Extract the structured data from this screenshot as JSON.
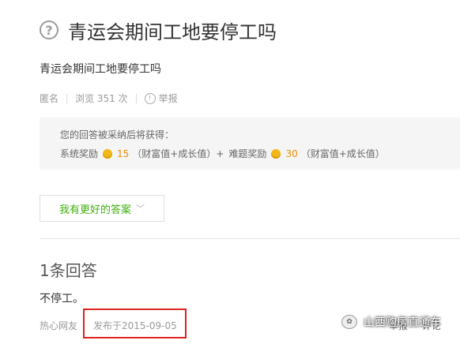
{
  "question": {
    "title": "青运会期间工地要停工吗",
    "description": "青运会期间工地要停工吗",
    "meta": {
      "anonymous": "匿名",
      "views": "浏览 351 次",
      "report": "举报"
    }
  },
  "reward": {
    "line1": "您的回答被采纳后将获得：",
    "system_label": "系统奖励",
    "system_value": "15",
    "system_unit": "（财富值+成长值）+",
    "bounty_label": "难题奖励",
    "bounty_value": "30",
    "bounty_unit": "（财富值+成长值）"
  },
  "better_answer_button": "我有更好的答案",
  "answers": {
    "count_label": "1条回答",
    "items": [
      {
        "text": "不停工。",
        "author": "热心网友",
        "date": "发布于2015-09-05",
        "actions": [
          "举报",
          "评论"
        ]
      }
    ]
  },
  "watermark": "山西购房直通车",
  "colors": {
    "accent_green": "#3eaf0e",
    "highlight_red": "#e02020",
    "coin_orange": "#f08b00"
  }
}
